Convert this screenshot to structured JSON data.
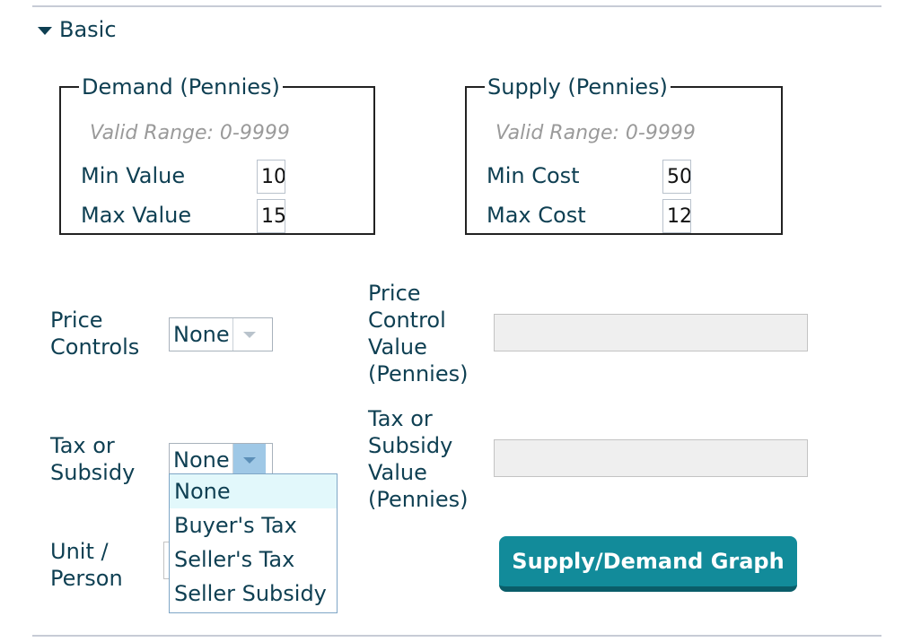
{
  "section": {
    "title": "Basic"
  },
  "demand": {
    "legend": "Demand (Pennies)",
    "hint": "Valid Range: 0-9999",
    "min_label": "Min Value",
    "max_label": "Max Value",
    "min_value": "10",
    "max_value": "15"
  },
  "supply": {
    "legend": "Supply (Pennies)",
    "hint": "Valid Range: 0-9999",
    "min_label": "Min Cost",
    "max_label": "Max Cost",
    "min_value": "50",
    "max_value": "12"
  },
  "price_controls": {
    "label_line1": "Price",
    "label_line2": "Controls",
    "selected": "None",
    "value_label": [
      "Price",
      "Control",
      "Value",
      "(Pennies)"
    ],
    "value": ""
  },
  "tax_subsidy": {
    "label_line1": "Tax or",
    "label_line2": "Subsidy",
    "selected": "None",
    "value_label": [
      "Tax or",
      "Subsidy",
      "Value",
      "(Pennies)"
    ],
    "value": "",
    "options": [
      "None",
      "Buyer's Tax",
      "Seller's Tax",
      "Seller Subsidy"
    ]
  },
  "unit_person": {
    "label_line1": "Unit /",
    "label_line2": "Person"
  },
  "graph_button": {
    "label": "Supply/Demand Graph"
  }
}
